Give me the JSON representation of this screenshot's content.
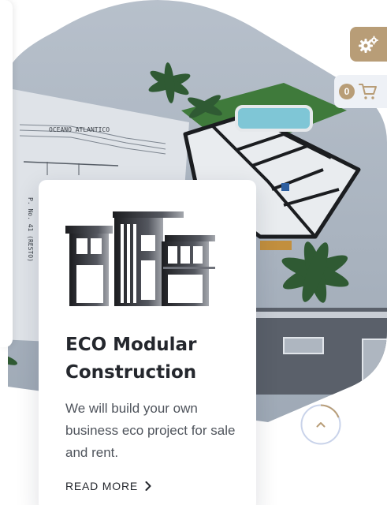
{
  "card": {
    "title": "ECO Modular Construction",
    "description": "We will build your own business eco project for sale and rent.",
    "read_more": "READ MORE"
  },
  "plan": {
    "label": "OCEANO ATLANTICO",
    "side_label": "P. No. 41 (RESTO)"
  },
  "cart": {
    "count": "0"
  },
  "icons": {
    "settings": "gears-icon",
    "cart": "cart-icon",
    "read_more": "chevron-right-icon",
    "scroll_top": "chevron-up-icon"
  },
  "colors": {
    "accent": "#b89d77",
    "heading": "#24272d",
    "body_text": "#4f545c",
    "scroll_ring": "#c9d3ea"
  }
}
